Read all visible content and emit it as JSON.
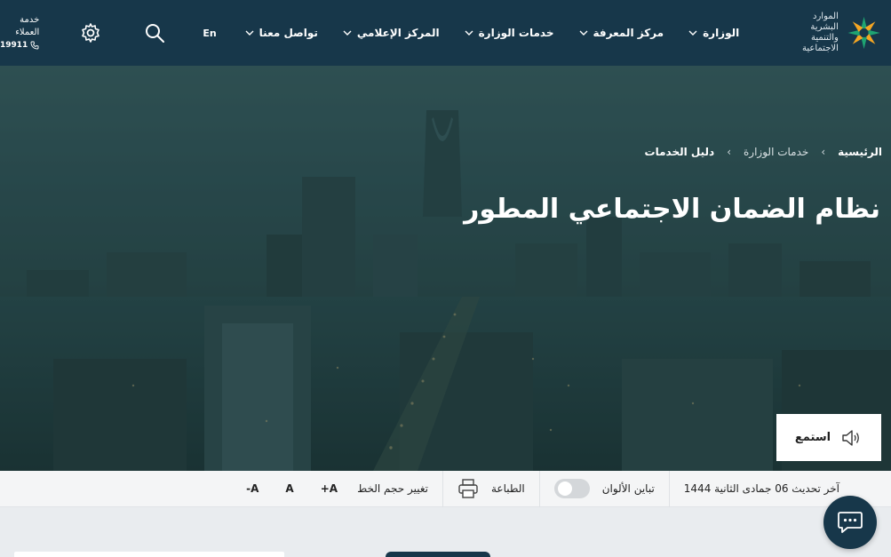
{
  "header": {
    "logo_line1": "الموارد البشرية",
    "logo_line2": "والتنمية الاجتماعية",
    "nav": [
      {
        "label": "الوزارة"
      },
      {
        "label": "مركز المعرفة"
      },
      {
        "label": "خدمات الوزارة"
      },
      {
        "label": "المركز الإعلامي"
      },
      {
        "label": "تواصل معنا"
      }
    ],
    "lang_label": "En",
    "customer_service_label": "خدمة العملاء",
    "customer_service_number": "19911"
  },
  "breadcrumb": {
    "home": "الرئيسية",
    "level1": "خدمات الوزارة",
    "current": "دليل الخدمات"
  },
  "page_title": "نظام الضمان الاجتماعي المطور",
  "listen_label": "استمع",
  "toolbar": {
    "last_update": "آخر تحديث 06 جمادى الثانية 1444",
    "contrast_label": "تباين الألوان",
    "print_label": "الطباعة",
    "font_size_label": "تغيير حجم الخط",
    "font_increase": "A+",
    "font_reset": "A",
    "font_decrease": "A-"
  },
  "colors": {
    "header_bg": "#17374a",
    "accent_green": "#1ea472",
    "accent_orange": "#f5a623"
  }
}
